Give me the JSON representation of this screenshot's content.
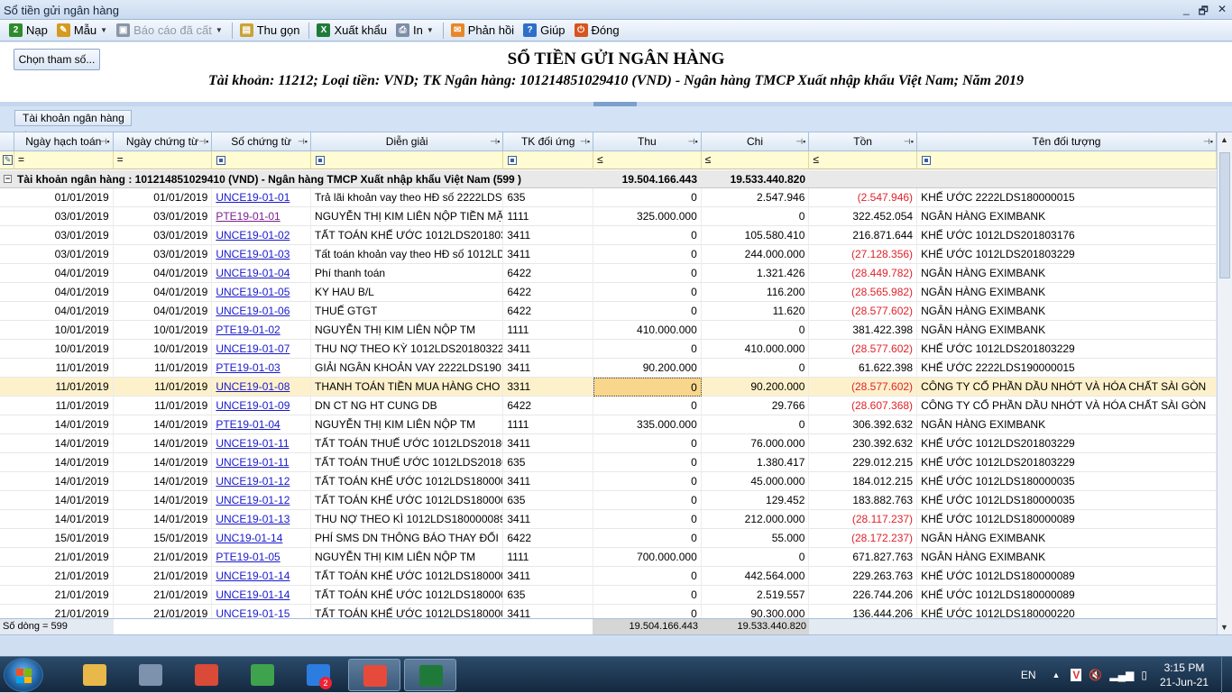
{
  "window": {
    "title": "Sổ tiền gửi ngân hàng",
    "controls": [
      "_",
      "🗗",
      "✕"
    ]
  },
  "toolbar": [
    {
      "label": "Nạp",
      "icon": "refresh-icon",
      "color": "#2e8b2e",
      "glyph": "2",
      "dd": false,
      "enabled": true
    },
    {
      "label": "Mẫu",
      "icon": "template-icon",
      "color": "#d59a20",
      "glyph": "✎",
      "dd": true,
      "enabled": true
    },
    {
      "label": "Báo cáo đã cất",
      "icon": "save-icon",
      "color": "#8a96a8",
      "glyph": "▣",
      "dd": true,
      "enabled": false
    },
    {
      "label": "Thu gọn",
      "icon": "collapse-icon",
      "color": "#caa23a",
      "glyph": "▤",
      "dd": false,
      "enabled": true
    },
    {
      "label": "Xuất khẩu",
      "icon": "excel-icon",
      "color": "#1f7a3a",
      "glyph": "X",
      "dd": false,
      "enabled": true
    },
    {
      "label": "In",
      "icon": "printer-icon",
      "color": "#7c8ea8",
      "glyph": "⎙",
      "dd": true,
      "enabled": true
    },
    {
      "label": "Phản hồi",
      "icon": "mail-icon",
      "color": "#e8862a",
      "glyph": "✉",
      "dd": false,
      "enabled": true
    },
    {
      "label": "Giúp",
      "icon": "help-icon",
      "color": "#2e6fc8",
      "glyph": "?",
      "dd": false,
      "enabled": true
    },
    {
      "label": "Đóng",
      "icon": "close-icon",
      "color": "#d9531e",
      "glyph": "⏻",
      "dd": false,
      "enabled": true
    }
  ],
  "report": {
    "param_button": "Chọn tham số...",
    "title": "SỔ TIỀN GỬI NGÂN HÀNG",
    "subtitle": "Tài khoản: 11212; Loại tiền: VND; TK Ngân hàng: 101214851029410 (VND) - Ngân hàng TMCP Xuất nhập khẩu Việt Nam; Năm 2019"
  },
  "group_panel": {
    "label": "Tài khoản ngân hàng",
    "sort_icon": "△"
  },
  "columns": [
    {
      "label": "Ngày hạch toán",
      "filter": "="
    },
    {
      "label": "Ngày chứng từ",
      "filter": "="
    },
    {
      "label": "Số chứng từ",
      "filter": "icon"
    },
    {
      "label": "Diễn giải",
      "filter": "icon"
    },
    {
      "label": "TK đối ứng",
      "filter": "icon"
    },
    {
      "label": "Thu",
      "filter": "≤"
    },
    {
      "label": "Chi",
      "filter": "≤"
    },
    {
      "label": "Tồn",
      "filter": "≤"
    },
    {
      "label": "Tên đối tượng",
      "filter": "icon"
    }
  ],
  "group_row": {
    "label": "Tài khoản ngân hàng : 101214851029410 (VND) - Ngân hàng TMCP Xuất nhập khẩu Việt Nam (599 )",
    "thu": "19.504.166.443",
    "chi": "19.533.440.820",
    "expander": "−"
  },
  "rows": [
    [
      "01/01/2019",
      "01/01/2019",
      "UNCE19-01-01",
      "Trả lãi khoản vay theo HĐ số 2222LDS",
      "635",
      "0",
      "2.547.946",
      "(2.547.946)",
      "KHẾ ƯỚC 2222LDS180000015"
    ],
    [
      "03/01/2019",
      "03/01/2019",
      "PTE19-01-01",
      "NGUYỄN THỊ KIM LIÊN NỘP TIỀN MẶ",
      "1111",
      "325.000.000",
      "0",
      "322.452.054",
      "NGÂN HÀNG EXIMBANK"
    ],
    [
      "03/01/2019",
      "03/01/2019",
      "UNCE19-01-02",
      "TẤT TOÁN KHẾ ƯỚC 1012LDS201803",
      "3411",
      "0",
      "105.580.410",
      "216.871.644",
      "KHẾ ƯỚC 1012LDS201803176"
    ],
    [
      "03/01/2019",
      "03/01/2019",
      "UNCE19-01-03",
      "Tất toán khoản vay theo HĐ số 1012LD",
      "3411",
      "0",
      "244.000.000",
      "(27.128.356)",
      "KHẾ ƯỚC 1012LDS201803229"
    ],
    [
      "04/01/2019",
      "04/01/2019",
      "UNCE19-01-04",
      "Phí thanh toán",
      "6422",
      "0",
      "1.321.426",
      "(28.449.782)",
      "NGÂN HÀNG EXIMBANK"
    ],
    [
      "04/01/2019",
      "04/01/2019",
      "UNCE19-01-05",
      "KY HAU B/L",
      "6422",
      "0",
      "116.200",
      "(28.565.982)",
      "NGÂN HÀNG EXIMBANK"
    ],
    [
      "04/01/2019",
      "04/01/2019",
      "UNCE19-01-06",
      "THUẾ GTGT",
      "6422",
      "0",
      "11.620",
      "(28.577.602)",
      "NGÂN HÀNG EXIMBANK"
    ],
    [
      "10/01/2019",
      "10/01/2019",
      "PTE19-01-02",
      "NGUYỄN THỊ KIM LIÊN NỘP TM",
      "1111",
      "410.000.000",
      "0",
      "381.422.398",
      "NGÂN HÀNG EXIMBANK"
    ],
    [
      "10/01/2019",
      "10/01/2019",
      "UNCE19-01-07",
      "THU NỢ THEO KỲ 1012LDS20180322",
      "3411",
      "0",
      "410.000.000",
      "(28.577.602)",
      "KHẾ ƯỚC 1012LDS201803229"
    ],
    [
      "11/01/2019",
      "11/01/2019",
      "PTE19-01-03",
      "GIẢI NGÂN KHOẢN VAY 2222LDS190",
      "3411",
      "90.200.000",
      "0",
      "61.622.398",
      "KHẾ ƯỚC 2222LDS190000015"
    ],
    [
      "11/01/2019",
      "11/01/2019",
      "UNCE19-01-08",
      "THANH TOÁN TIỀN MUA HÀNG CHO",
      "3311",
      "0",
      "90.200.000",
      "(28.577.602)",
      "CÔNG TY CỔ PHẦN DẦU NHỚT VÀ HÓA CHẤT SÀI GÒN"
    ],
    [
      "11/01/2019",
      "11/01/2019",
      "UNCE19-01-09",
      "DN CT NG HT CUNG DB",
      "6422",
      "0",
      "29.766",
      "(28.607.368)",
      "CÔNG TY CỔ PHẦN DẦU NHỚT VÀ HÓA CHẤT SÀI GÒN"
    ],
    [
      "14/01/2019",
      "14/01/2019",
      "PTE19-01-04",
      "NGUYỄN THỊ KIM LIÊN NỘP TM",
      "1111",
      "335.000.000",
      "0",
      "306.392.632",
      "NGÂN HÀNG EXIMBANK"
    ],
    [
      "14/01/2019",
      "14/01/2019",
      "UNCE19-01-11",
      "TẤT TOÁN THUẾ ƯỚC 1012LDS20180",
      "3411",
      "0",
      "76.000.000",
      "230.392.632",
      "KHẾ ƯỚC 1012LDS201803229"
    ],
    [
      "14/01/2019",
      "14/01/2019",
      "UNCE19-01-11",
      "TẤT TOÁN THUẾ ƯỚC 1012LDS20180",
      "635",
      "0",
      "1.380.417",
      "229.012.215",
      "KHẾ ƯỚC 1012LDS201803229"
    ],
    [
      "14/01/2019",
      "14/01/2019",
      "UNCE19-01-12",
      "TẤT TOÁN KHẾ ƯỚC 1012LDS180000",
      "3411",
      "0",
      "45.000.000",
      "184.012.215",
      "KHẾ ƯỚC 1012LDS180000035"
    ],
    [
      "14/01/2019",
      "14/01/2019",
      "UNCE19-01-12",
      "TẤT TOÁN KHẾ ƯỚC 1012LDS180000",
      "635",
      "0",
      "129.452",
      "183.882.763",
      "KHẾ ƯỚC 1012LDS180000035"
    ],
    [
      "14/01/2019",
      "14/01/2019",
      "UNCE19-01-13",
      "THU NỢ THEO KÌ 1012LDS180000089",
      "3411",
      "0",
      "212.000.000",
      "(28.117.237)",
      "KHẾ ƯỚC 1012LDS180000089"
    ],
    [
      "15/01/2019",
      "15/01/2019",
      "UNC19-01-14",
      "PHÍ SMS DN THÔNG BÁO THAY ĐỔI",
      "6422",
      "0",
      "55.000",
      "(28.172.237)",
      "NGÂN HÀNG EXIMBANK"
    ],
    [
      "21/01/2019",
      "21/01/2019",
      "PTE19-01-05",
      "NGUYỄN THỊ KIM LIÊN NỘP TM",
      "1111",
      "700.000.000",
      "0",
      "671.827.763",
      "NGÂN HÀNG EXIMBANK"
    ],
    [
      "21/01/2019",
      "21/01/2019",
      "UNCE19-01-14",
      "TẤT TOÁN KHẾ ƯỚC 1012LDS180000",
      "3411",
      "0",
      "442.564.000",
      "229.263.763",
      "KHẾ ƯỚC 1012LDS180000089"
    ],
    [
      "21/01/2019",
      "21/01/2019",
      "UNCE19-01-14",
      "TẤT TOÁN KHẾ ƯỚC 1012LDS180000",
      "635",
      "0",
      "2.519.557",
      "226.744.206",
      "KHẾ ƯỚC 1012LDS180000089"
    ],
    [
      "21/01/2019",
      "21/01/2019",
      "UNCE19-01-15",
      "TẤT TOÁN KHẾ ƯỚC 1012LDS180000",
      "3411",
      "0",
      "90.300.000",
      "136.444.206",
      "KHẾ ƯỚC 1012LDS180000220"
    ]
  ],
  "selected_row": 10,
  "visited_link_row": 1,
  "footer": {
    "count": "Số dòng = 599",
    "thu": "19.504.166.443",
    "chi": "19.533.440.820"
  },
  "taskbar": {
    "apps": [
      {
        "name": "explorer",
        "color": "#e8b84a",
        "active": false
      },
      {
        "name": "calculator",
        "color": "#7d93ad",
        "active": false
      },
      {
        "name": "chrome",
        "color": "#d94a38",
        "active": false
      },
      {
        "name": "coccoc",
        "color": "#3fa34d",
        "active": false
      },
      {
        "name": "zalo",
        "color": "#2c7de0",
        "active": false,
        "badge": "2"
      },
      {
        "name": "misa",
        "color": "#e64a3b",
        "active": true
      },
      {
        "name": "excel",
        "color": "#1f7a3a",
        "active": true
      }
    ],
    "lang": "EN",
    "time": "3:15 PM",
    "date": "21-Jun-21"
  },
  "colors": {
    "negative": "#e0222a",
    "link": "#1a1acc",
    "selected_row": "#fdf1cc"
  }
}
